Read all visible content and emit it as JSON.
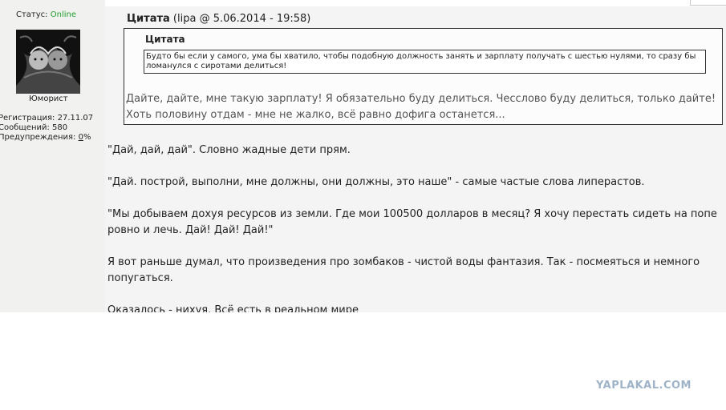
{
  "user": {
    "status_label": "Статус:",
    "status_value": "Online",
    "title": "Юморист",
    "registration": "Регистрация: 27.11.07",
    "messages": "Сообщений: 580",
    "warnings_label": "Предупреждения: ",
    "warnings_value": "0",
    "warnings_suffix": "%"
  },
  "post": {
    "quote_label": "Цитата",
    "quote_meta": " (lipa @ 5.06.2014 - 19:58)",
    "inner_quote_title": "Цитата",
    "inner_quote_text": "Будто бы если у самого, ума бы хватило, чтобы подобную должность занять и зарплату получать с шестью нулями, то сразу бы ломанулся с сиротами делиться!",
    "outer_quote_text": "Дайте, дайте, мне такую зарплату! Я обязательно буду делиться. Чесслово буду делиться, только дайте! Хоть половину отдам - мне не жалко, всё равно дофига останется...",
    "paragraphs": [
      "\"Дай, дай, дай\". Словно жадные дети прям.",
      "\"Дай. построй, выполни, мне должны, они должны, это наше\" - самые частые слова липерастов.",
      "\"Мы добываем дохуя ресурсов из земли. Где мои 100500 долларов в месяц? Я хочу перестать сидеть на попе ровно и лечь. Дай! Дай! Дай!\"",
      "Я вот раньше думал, что произведения про зомбаков - чистой воды фантазия. Так - посмеяться и немного попугаться.",
      "Оказалось - нихуя. Всё есть в реальном мире"
    ]
  },
  "watermark": "YAPLAKAL.COM",
  "colors": {
    "online": "#1e9e2a",
    "panel_bg": "#f1f1ef",
    "watermark": "#9fb3c8"
  }
}
